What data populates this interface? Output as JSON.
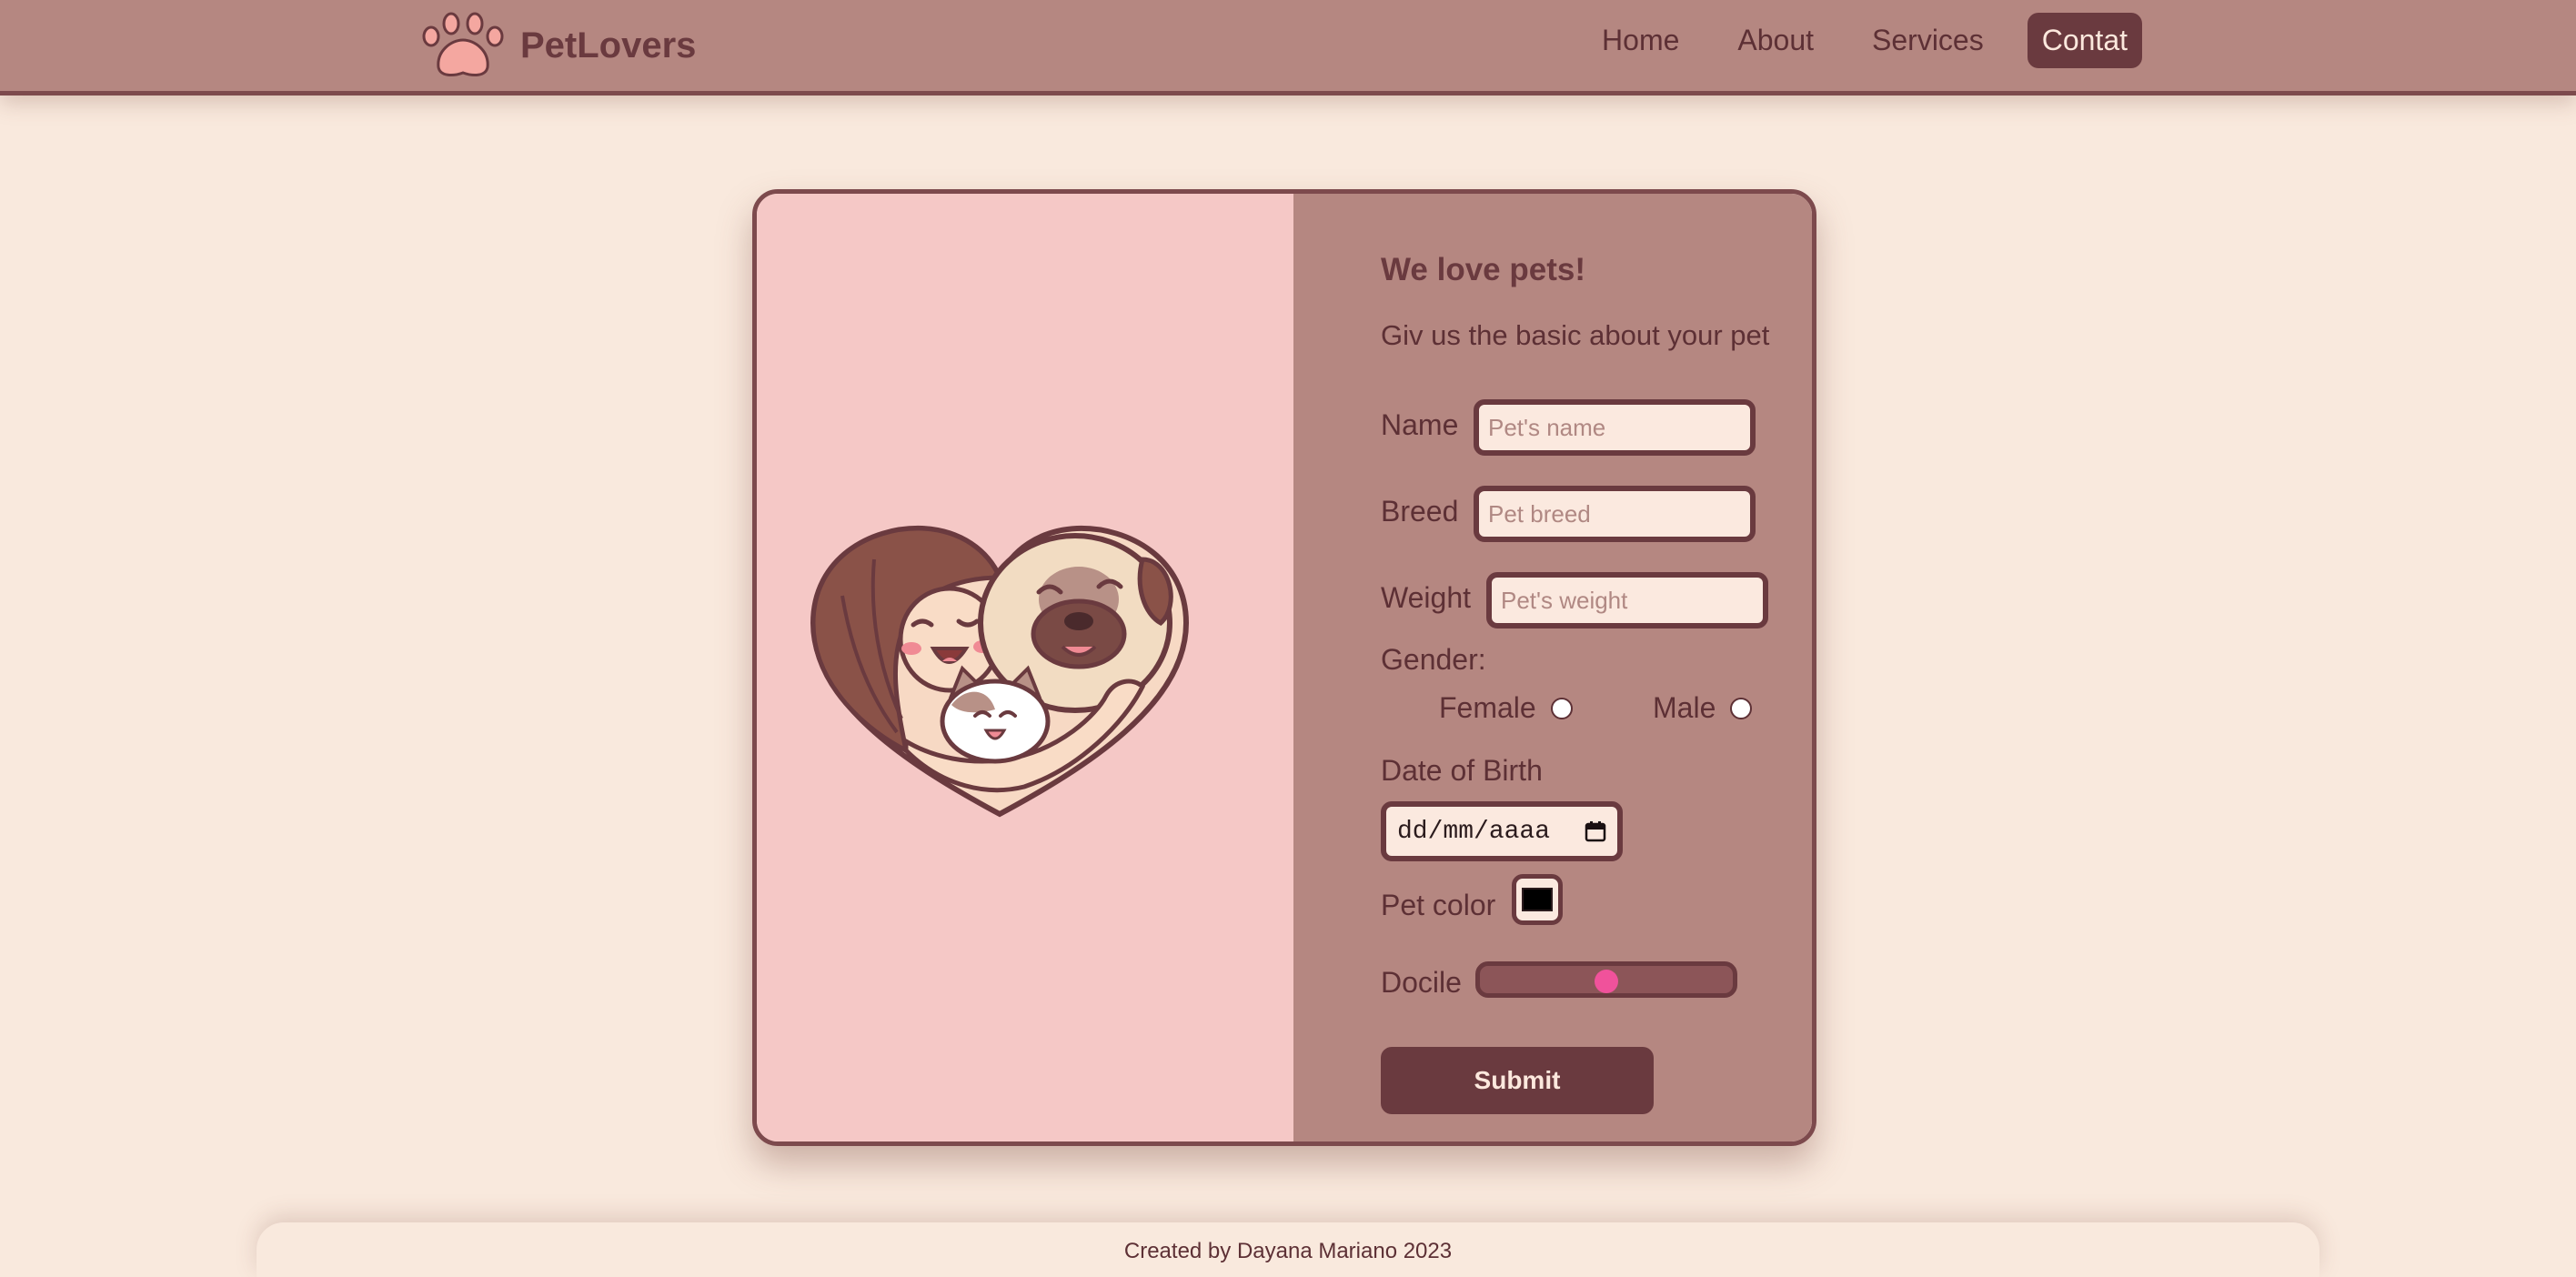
{
  "header": {
    "brand_name": "PetLovers",
    "nav": [
      {
        "label": "Home",
        "active": false
      },
      {
        "label": "About",
        "active": false
      },
      {
        "label": "Services",
        "active": false
      },
      {
        "label": "Contat",
        "active": true
      }
    ]
  },
  "form": {
    "title": "We love pets!",
    "subtitle": "Giv us the basic about your pet",
    "name": {
      "label": "Name",
      "placeholder": "Pet's name",
      "value": ""
    },
    "breed": {
      "label": "Breed",
      "placeholder": "Pet breed",
      "value": ""
    },
    "weight": {
      "label": "Weight",
      "placeholder": "Pet's weight",
      "value": ""
    },
    "gender": {
      "label": "Gender:",
      "options": [
        "Female",
        "Male"
      ],
      "selected": null
    },
    "dob": {
      "label": "Date of Birth",
      "value": "dd/mm/aaaa",
      "icon": "calendar-icon"
    },
    "color": {
      "label": "Pet color",
      "value": "#000000"
    },
    "docile": {
      "label": "Docile",
      "value": 50,
      "min": 0,
      "max": 100
    },
    "submit_label": "Submit"
  },
  "footer": {
    "text": "Created by Dayana Mariano 2023"
  },
  "colors": {
    "background": "#f9e9dd",
    "header": "#b58781",
    "accent_dark": "#6a3a3f",
    "card_left": "#f5c8c6",
    "slider_thumb": "#f0529b"
  },
  "icons": [
    "paw-logo-icon",
    "calendar-icon"
  ],
  "illustration": "heart-girl-pug-cat-illustration"
}
